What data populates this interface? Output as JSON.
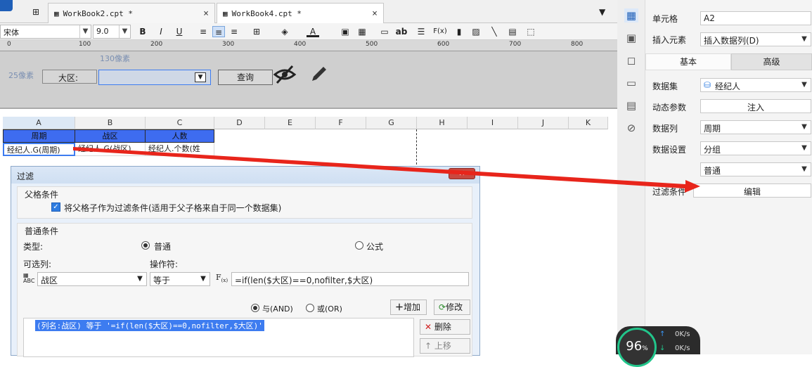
{
  "tabs": [
    {
      "label": "WorkBook2.cpt *",
      "close": "×"
    },
    {
      "label": "WorkBook4.cpt *",
      "close": "×"
    }
  ],
  "toolbar": {
    "font_name": "宋体",
    "font_size": "9.0",
    "bold": "B",
    "italic": "I",
    "underline": "U",
    "text_abc": "ab",
    "formula": "F(x)"
  },
  "ruler": {
    "ticks": [
      "0",
      "100",
      "200",
      "300",
      "400",
      "500",
      "600",
      "700",
      "800"
    ]
  },
  "design": {
    "width_note": "130像素",
    "height_note": "25像素",
    "region_label": "大区:",
    "query_button": "查询"
  },
  "grid": {
    "columns": [
      "A",
      "B",
      "C",
      "D",
      "E",
      "F",
      "G",
      "H",
      "I",
      "J",
      "K"
    ],
    "header_row": [
      "周期",
      "战区",
      "人数"
    ],
    "data_row": [
      "经纪人.G(周期)",
      "经纪人.G(战区)",
      "经纪人.个数(姓"
    ]
  },
  "dialog": {
    "title": "过滤",
    "close": "✕",
    "parent_group_title": "父格条件",
    "parent_checkbox_label": "将父格子作为过滤条件(适用于父子格来自于同一个数据集)",
    "normal_group_title": "普通条件",
    "type_label": "类型:",
    "radio_normal": "普通",
    "radio_formula": "公式",
    "optional_column_label": "可选列:",
    "operator_label": "操作符:",
    "column_value": "战区",
    "operator_value": "等于",
    "formula_value": "=if(len($大区)==0,nofilter,$大区)",
    "and_label": "与(AND)",
    "or_label": "或(OR)",
    "add_button": "增加",
    "modify_button": "修改",
    "delete_button": "删除",
    "up_button": "上移",
    "condition_item": "(列名:战区) 等于 '=if(len($大区)==0,nofilter,$大区)'"
  },
  "right_panel": {
    "cell_label": "单元格",
    "cell_value": "A2",
    "insert_label": "插入元素",
    "insert_value": "插入数据列(D)",
    "tab_basic": "基本",
    "tab_advanced": "高级",
    "dataset_label": "数据集",
    "dataset_value": "经纪人",
    "dyn_param_label": "动态参数",
    "inject_button": "注入",
    "data_column_label": "数据列",
    "data_column_value": "周期",
    "data_setting_label": "数据设置",
    "data_setting_value": "分组",
    "data_setting_value2": "普通",
    "filter_label": "过滤条件",
    "edit_button": "编辑"
  },
  "widget": {
    "percent": "96",
    "unit": "%",
    "up_speed": "0K/s",
    "down_speed": "0K/s"
  },
  "colors": {
    "header_blue": "#3e6cf0",
    "arrow_red": "#e8251b",
    "selection_blue": "#3d7cf0"
  }
}
